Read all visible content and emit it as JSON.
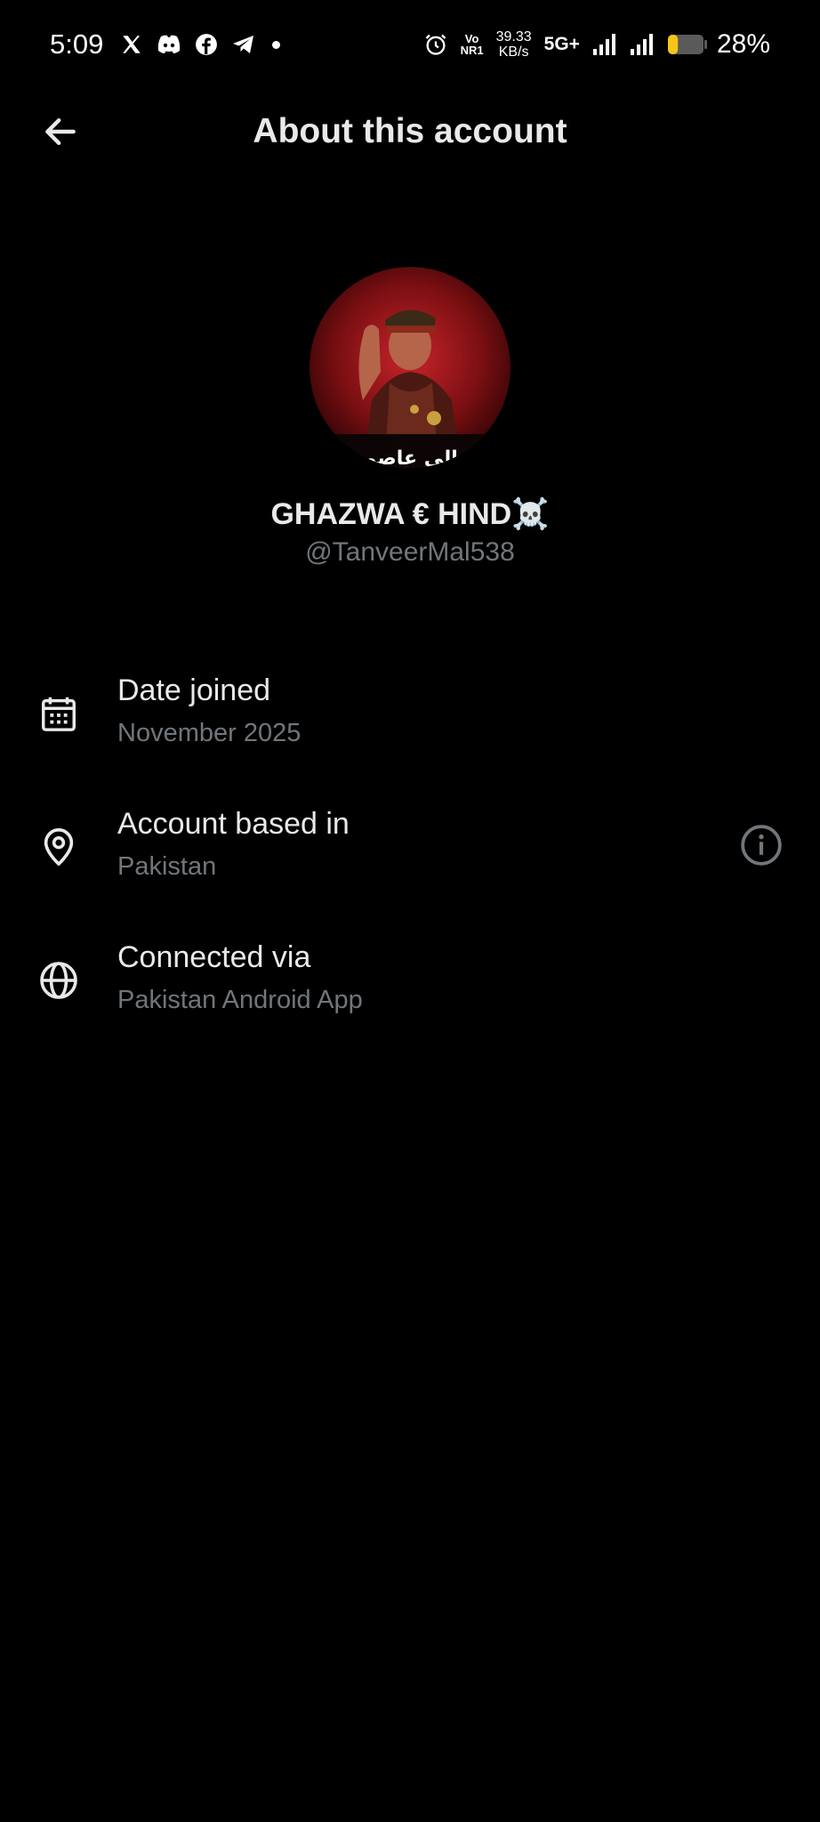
{
  "status_bar": {
    "time": "5:09",
    "apps": [
      "x-icon",
      "discord-icon",
      "facebook-icon",
      "telegram-icon"
    ],
    "volte_top": "Vo",
    "volte_bottom": "NR1",
    "net_speed_value": "39.33",
    "net_speed_unit": "KB/s",
    "network_type": "5G+",
    "battery_percent": "28%",
    "battery_level": 0.28,
    "battery_color": "#f5c518"
  },
  "header": {
    "title": "About this account",
    "back_icon": "arrow-left-icon"
  },
  "profile": {
    "display_name": "GHAZWA € HIND☠️",
    "handle": "@TanveerMal538",
    "avatar_text": "إلى عاصم"
  },
  "info_rows": [
    {
      "icon": "calendar-icon",
      "label": "Date joined",
      "value": "November 2025"
    },
    {
      "icon": "location-pin-icon",
      "label": "Account based in",
      "value": "Pakistan",
      "has_info": true
    },
    {
      "icon": "globe-icon",
      "label": "Connected via",
      "value": "Pakistan Android App"
    }
  ],
  "colors": {
    "background": "#000000",
    "primary_text": "#e7e9ea",
    "secondary_text": "#71767b"
  }
}
